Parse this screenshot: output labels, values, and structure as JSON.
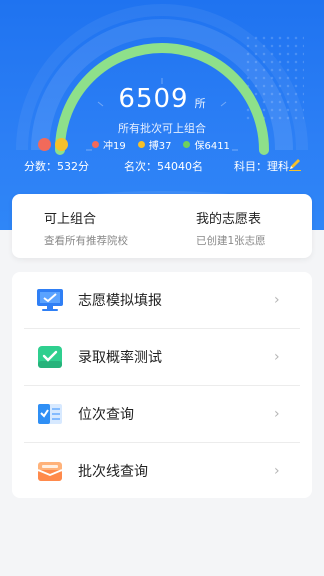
{
  "hero": {
    "count": "6509",
    "count_unit": "所",
    "caption": "所有批次可上组合",
    "tiers": [
      {
        "label": "冲19",
        "color": "#f26a5a"
      },
      {
        "label": "搏37",
        "color": "#f5c02a"
      },
      {
        "label": "保6411",
        "color": "#6fd05c"
      }
    ],
    "legend_dots": [
      "#f26a5a",
      "#f5c02a"
    ],
    "score": "分数：532分",
    "rank": "名次：54040名",
    "subject": "科目：理科"
  },
  "card": {
    "left_title": "可上组合",
    "left_desc": "查看所有推荐院校",
    "right_title": "我的志愿表",
    "right_desc": "已创建1张志愿"
  },
  "menu": {
    "items": [
      {
        "label": "志愿模拟填报",
        "icon": "monitor-icon"
      },
      {
        "label": "录取概率测试",
        "icon": "check-icon"
      },
      {
        "label": "位次查询",
        "icon": "list-check-icon"
      },
      {
        "label": "批次线查询",
        "icon": "envelope-icon"
      }
    ],
    "chevron": "›"
  },
  "colors": {
    "primary": "#1f73f0",
    "gauge": "#8ee08a"
  }
}
